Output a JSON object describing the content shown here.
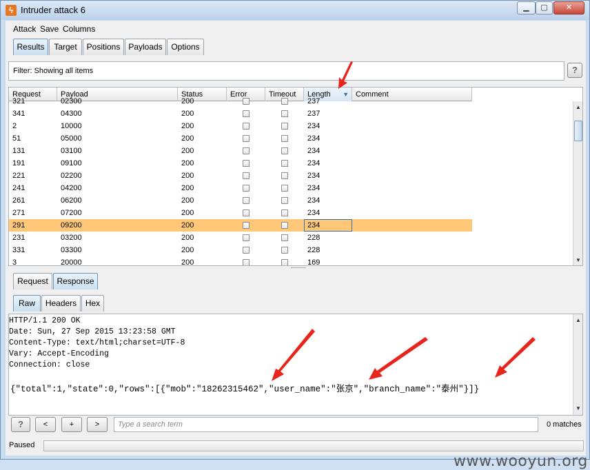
{
  "window": {
    "title": "Intruder attack 6",
    "icon": "burp-lightning-icon",
    "controls": [
      "minimize",
      "maximize",
      "close"
    ]
  },
  "menu": {
    "items": [
      "Attack",
      "Save",
      "Columns"
    ]
  },
  "main_tabs": [
    {
      "label": "Results",
      "active": true
    },
    {
      "label": "Target",
      "active": false
    },
    {
      "label": "Positions",
      "active": false
    },
    {
      "label": "Payloads",
      "active": false
    },
    {
      "label": "Options",
      "active": false
    }
  ],
  "filter": {
    "text": "Filter:  Showing all items",
    "help": "?"
  },
  "table": {
    "columns": [
      "Request",
      "Payload",
      "Status",
      "Error",
      "Timeout",
      "Length",
      "Comment"
    ],
    "sorted_column": "Length",
    "sort_direction": "descending",
    "rows": [
      {
        "request": "321",
        "payload": "02300",
        "status": "200",
        "length": "237",
        "partial": true
      },
      {
        "request": "341",
        "payload": "04300",
        "status": "200",
        "length": "237"
      },
      {
        "request": "2",
        "payload": "10000",
        "status": "200",
        "length": "234"
      },
      {
        "request": "51",
        "payload": "05000",
        "status": "200",
        "length": "234"
      },
      {
        "request": "131",
        "payload": "03100",
        "status": "200",
        "length": "234"
      },
      {
        "request": "191",
        "payload": "09100",
        "status": "200",
        "length": "234"
      },
      {
        "request": "221",
        "payload": "02200",
        "status": "200",
        "length": "234"
      },
      {
        "request": "241",
        "payload": "04200",
        "status": "200",
        "length": "234"
      },
      {
        "request": "261",
        "payload": "06200",
        "status": "200",
        "length": "234"
      },
      {
        "request": "271",
        "payload": "07200",
        "status": "200",
        "length": "234"
      },
      {
        "request": "291",
        "payload": "09200",
        "status": "200",
        "length": "234",
        "selected": true
      },
      {
        "request": "231",
        "payload": "03200",
        "status": "200",
        "length": "228"
      },
      {
        "request": "331",
        "payload": "03300",
        "status": "200",
        "length": "228"
      },
      {
        "request": "3",
        "payload": "20000",
        "status": "200",
        "length": "169"
      }
    ]
  },
  "detail_tabs": [
    {
      "label": "Request",
      "active": false
    },
    {
      "label": "Response",
      "active": true
    }
  ],
  "view_tabs": [
    {
      "label": "Raw",
      "active": true
    },
    {
      "label": "Headers",
      "active": false
    },
    {
      "label": "Hex",
      "active": false
    }
  ],
  "response": {
    "headers": [
      "HTTP/1.1 200 OK",
      "Date: Sun, 27 Sep 2015 13:23:58 GMT",
      "Content-Type: text/html;charset=UTF-8",
      "Vary: Accept-Encoding",
      "Connection: close"
    ],
    "body": "{\"total\":1,\"state\":0,\"rows\":[{\"mob\":\"18262315462\",\"user_name\":\"张京\",\"branch_name\":\"泰州\"}]}"
  },
  "search": {
    "help": "?",
    "prev": "<",
    "add": "+",
    "next": ">",
    "placeholder": "Type a search term",
    "matches": "0 matches"
  },
  "status": {
    "text": "Paused"
  },
  "watermark": "www.wooyun.org",
  "annotation_color": "#e8251c"
}
